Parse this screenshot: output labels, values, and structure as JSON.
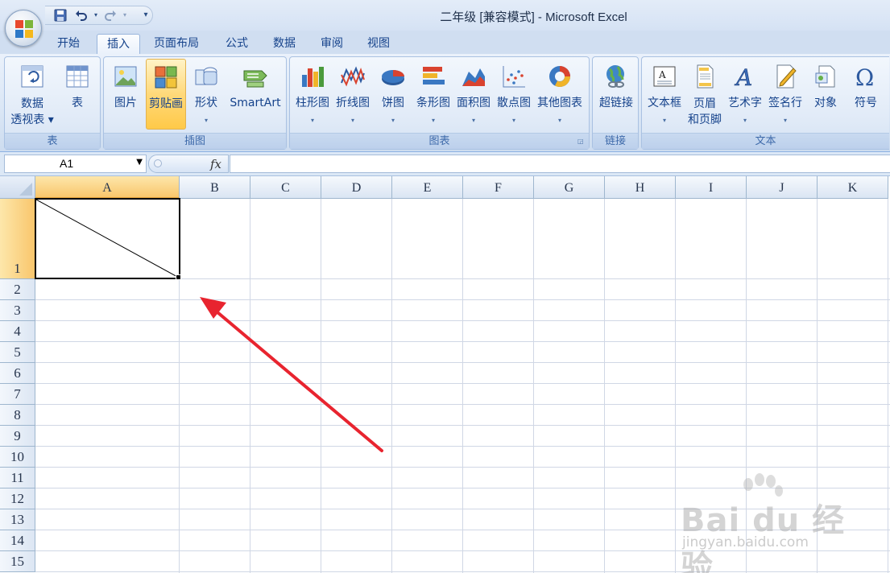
{
  "window": {
    "title": "二年级  [兼容模式] - Microsoft Excel"
  },
  "qat": {
    "icons": [
      "save-icon",
      "undo-icon",
      "redo-icon",
      "customize-icon"
    ]
  },
  "tabs": [
    {
      "label": "开始",
      "active": false
    },
    {
      "label": "插入",
      "active": true
    },
    {
      "label": "页面布局",
      "active": false
    },
    {
      "label": "公式",
      "active": false
    },
    {
      "label": "数据",
      "active": false
    },
    {
      "label": "审阅",
      "active": false
    },
    {
      "label": "视图",
      "active": false
    }
  ],
  "ribbon": {
    "groups": {
      "tables": {
        "label": "表",
        "buttons": {
          "pivot": {
            "line1": "数据",
            "line2": "透视表 ▾"
          },
          "table": {
            "label": "表"
          }
        }
      },
      "illustrations": {
        "label": "插图",
        "buttons": {
          "picture": "图片",
          "clipart": "剪贴画",
          "shapes": "形状",
          "smartart": "SmartArt"
        }
      },
      "charts": {
        "label": "图表",
        "buttons": {
          "column": "柱形图",
          "line": "折线图",
          "pie": "饼图",
          "bar": "条形图",
          "area": "面积图",
          "scatter": "散点图",
          "other": "其他图表"
        }
      },
      "links": {
        "label": "链接",
        "buttons": {
          "hyperlink": "超链接"
        }
      },
      "text": {
        "label": "文本",
        "buttons": {
          "textbox": "文本框",
          "header_line1": "页眉",
          "header_line2": "和页脚",
          "wordart": "艺术字",
          "signature": "签名行",
          "object": "对象",
          "symbol": "符号"
        }
      }
    },
    "highlight_color": "#ffc948"
  },
  "formula_bar": {
    "name_box": "A1",
    "fx_label": "fx",
    "value": ""
  },
  "sheet": {
    "columns": [
      "A",
      "B",
      "C",
      "D",
      "E",
      "F",
      "G",
      "H",
      "I",
      "J",
      "K"
    ],
    "rows": [
      "1",
      "2",
      "3",
      "4",
      "5",
      "6",
      "7",
      "8",
      "9",
      "10",
      "11",
      "12",
      "13",
      "14",
      "15"
    ],
    "selected_cell": "A1"
  },
  "annotation": {
    "arrow_color": "#e8242f"
  },
  "watermark": {
    "brand": "Bai du 经验",
    "url": "jingyan.baidu.com"
  }
}
